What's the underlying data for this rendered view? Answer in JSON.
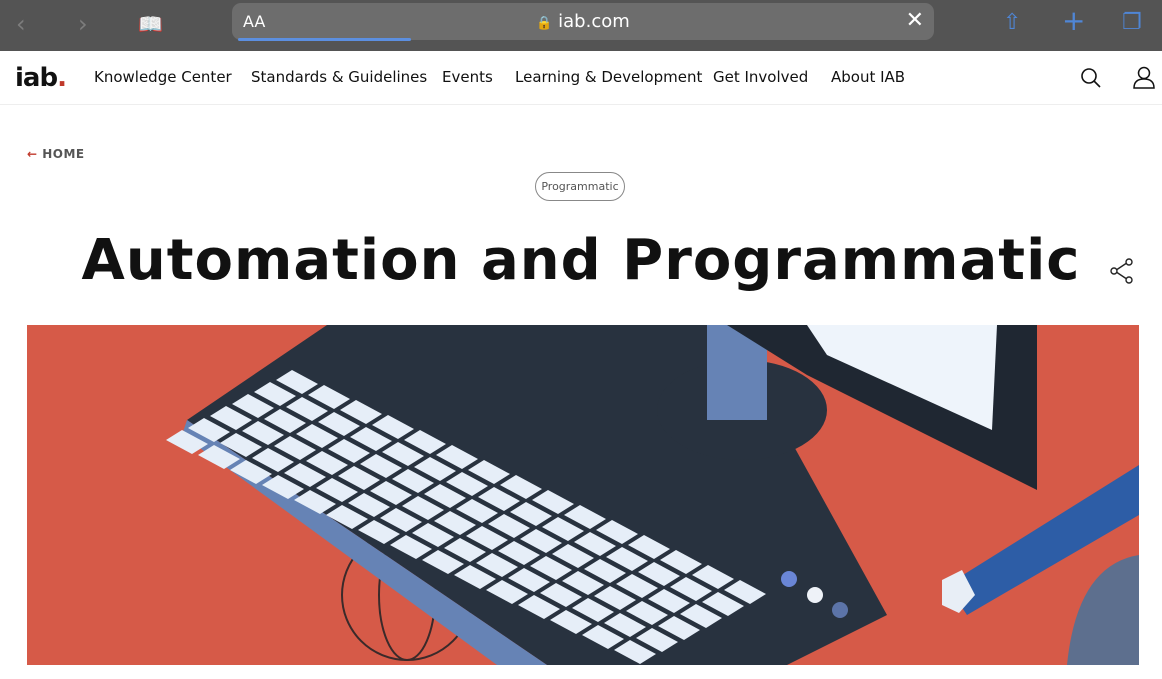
{
  "browser": {
    "text_size_label": "AA",
    "url": "iab.com",
    "load_progress_percent": 25,
    "icons": [
      "back-icon",
      "forward-icon",
      "bookmarks-icon",
      "lock-icon",
      "clear-icon",
      "share-icon",
      "new-tab-icon",
      "tabs-icon"
    ]
  },
  "site": {
    "logo": "iab.",
    "nav": [
      "Knowledge Center",
      "Standards & Guidelines",
      "Events",
      "Learning & Development",
      "Get Involved",
      "About IAB"
    ]
  },
  "page": {
    "back_label": "HOME",
    "tag": "Programmatic",
    "title": "Automation and Programmatic"
  },
  "colors": {
    "hero_bg": "#d65a48",
    "logo_dot": "#c0392b",
    "browser_accent": "#4f86d6"
  }
}
